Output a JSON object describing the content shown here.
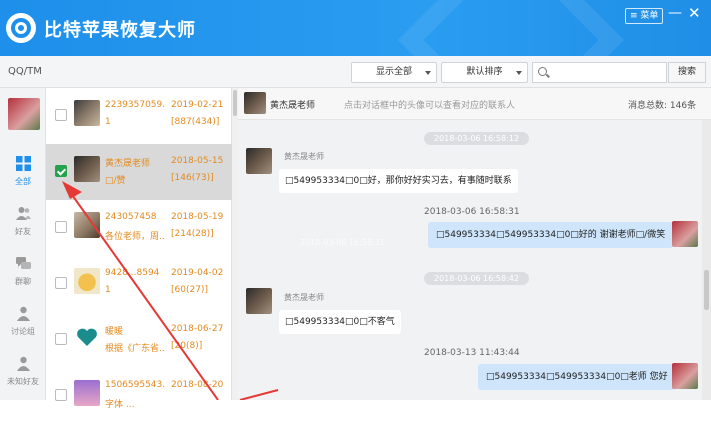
{
  "app": {
    "title": "比特苹果恢复大师",
    "menu_label": "菜单",
    "minimize": "—",
    "close": "✕"
  },
  "toolbar": {
    "account_label": "QQ/TM",
    "filter_value": "显示全部",
    "sort_value": "默认排序",
    "search_placeholder": "",
    "search_button": "搜索"
  },
  "nav": {
    "items": [
      {
        "label": "全部",
        "icon": "grid-icon",
        "active": true
      },
      {
        "label": "好友",
        "icon": "friends-icon",
        "active": false
      },
      {
        "label": "群聊",
        "icon": "chat-bubbles-icon",
        "active": false
      },
      {
        "label": "讨论组",
        "icon": "group-icon",
        "active": false
      },
      {
        "label": "未知好友",
        "icon": "unknown-user-icon",
        "active": false
      }
    ]
  },
  "contacts": [
    {
      "name": "2239357059...",
      "date": "2019-02-21",
      "sub": "1",
      "count": "[887(434)]",
      "checked": false
    },
    {
      "name": "黄杰晟老师",
      "date": "2018-05-15",
      "sub": "□/赞",
      "count": "[146(73)]",
      "checked": true
    },
    {
      "name": "243057458",
      "date": "2018-05-19",
      "sub": "各位老师，周...",
      "count": "[214(28)]",
      "checked": false
    },
    {
      "name": "9428...8594",
      "date": "2019-04-02",
      "sub": "1",
      "count": "[60(27)]",
      "checked": false
    },
    {
      "name": "暖暖",
      "date": "2018-06-27",
      "sub": "根据《广东省...",
      "count": "[20(8)]",
      "checked": false
    },
    {
      "name": "1506595543...",
      "date": "2018-08-20",
      "sub": "字体 ...",
      "count": "",
      "checked": false
    }
  ],
  "chat": {
    "header_name": "黄杰晟老师",
    "hint": "点击对话框中的头像可以查看对应的联系人",
    "total": "消息总数: 146条",
    "messages": [
      {
        "type": "pill",
        "text": "2018-03-06 16:58:12"
      },
      {
        "type": "in",
        "sender": "黄杰晟老师",
        "text": "□549953334□0□好，那你好好实习去，有事随时联系"
      },
      {
        "type": "time",
        "text": "2018-03-06 16:58:31"
      },
      {
        "type": "out",
        "text": "□549953334□549953334□0□好的 谢谢老师□/微笑"
      },
      {
        "type": "pill",
        "text": "2018-03-06 16:58:31"
      },
      {
        "type": "pill",
        "text": "2018-03-06 16:58:42"
      },
      {
        "type": "in",
        "sender": "黄杰晟老师",
        "text": "□549953334□0□不客气"
      },
      {
        "type": "time",
        "text": "2018-03-13 11:43:44"
      },
      {
        "type": "out",
        "text": "□549953334□549953334□0□老师 您好"
      }
    ]
  },
  "colors": {
    "brand": "#1e8fea",
    "accent_text": "#e48a1f",
    "arrow": "#e53935",
    "check": "#22a24a"
  }
}
